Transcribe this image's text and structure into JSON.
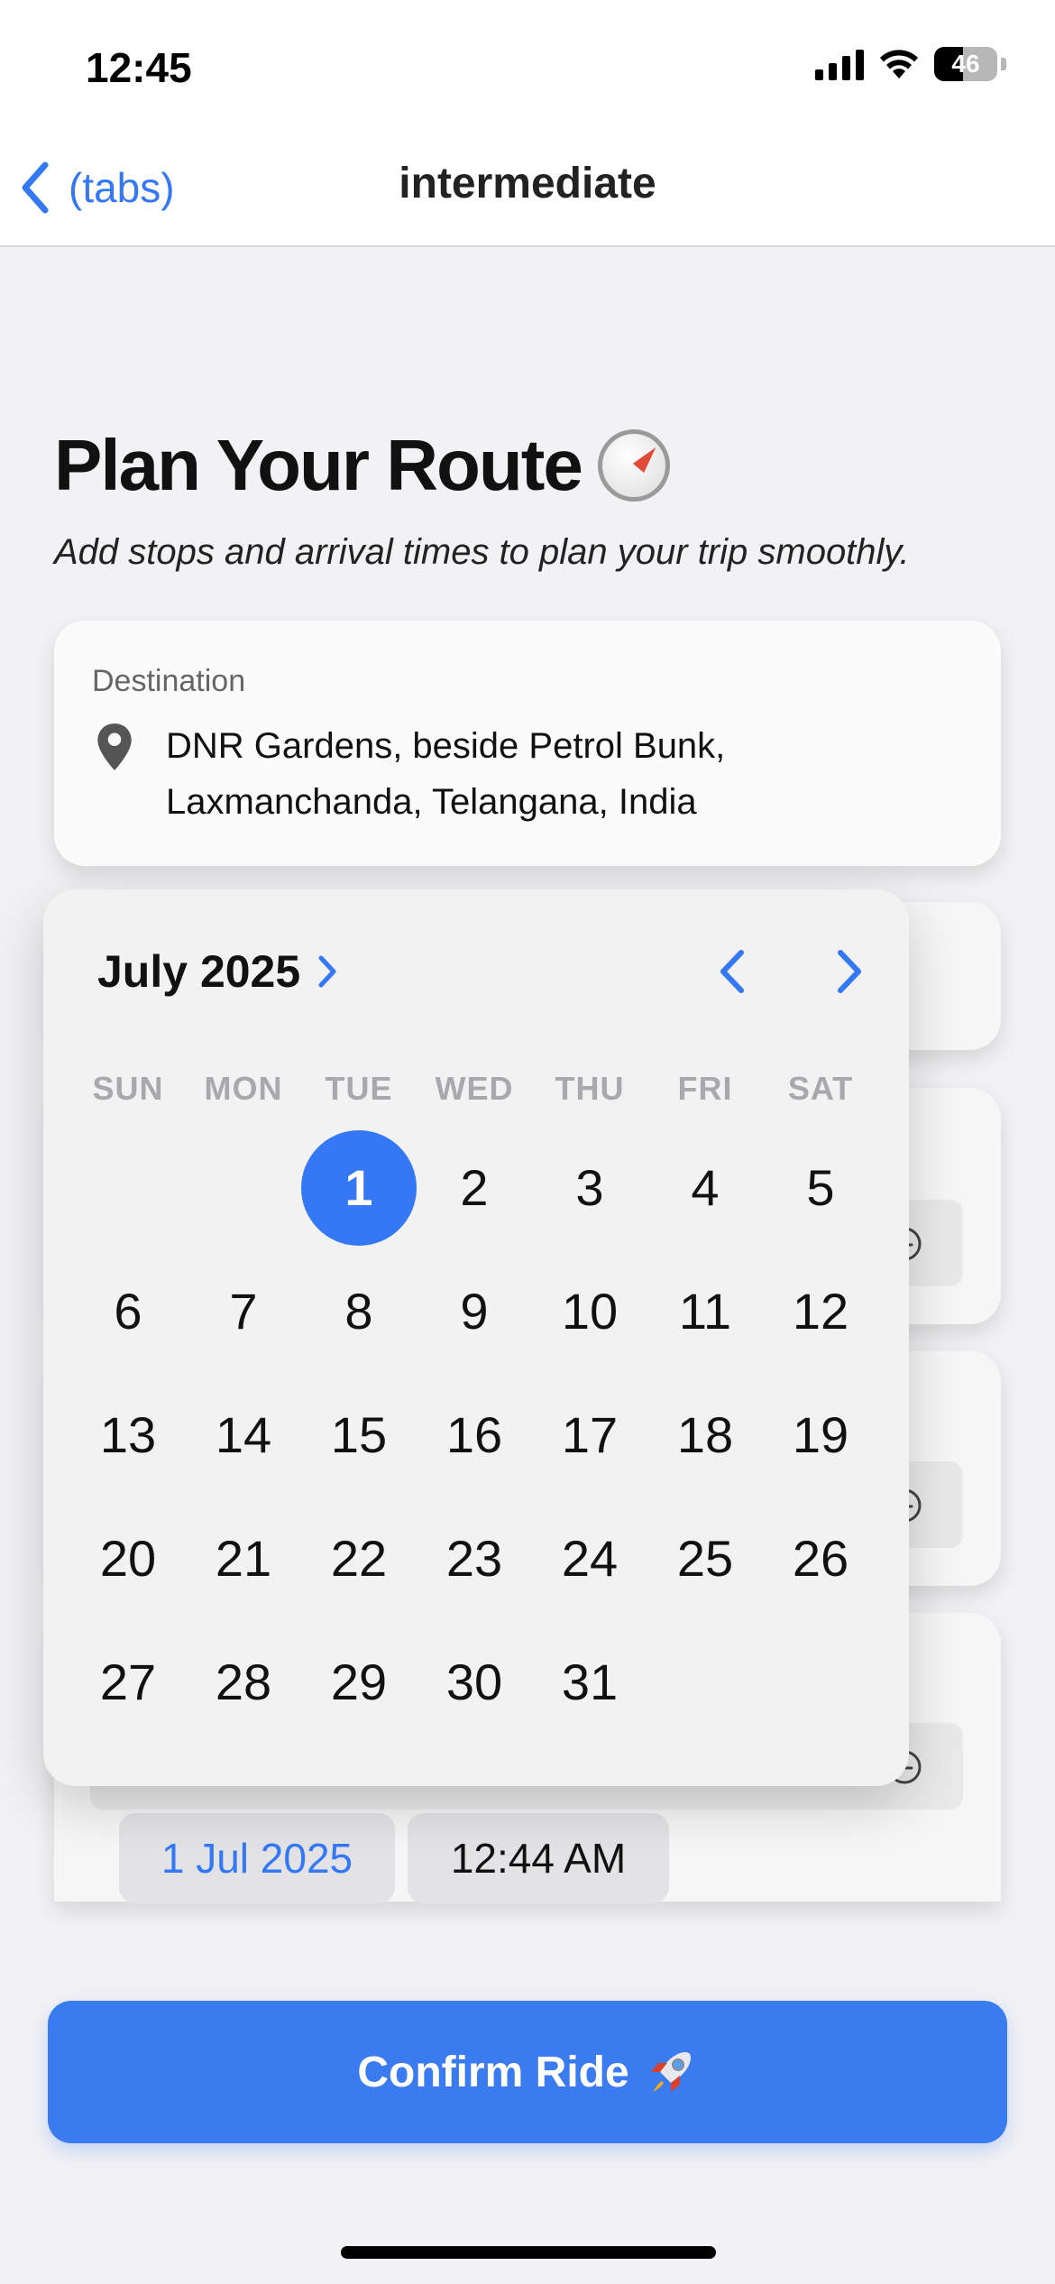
{
  "status_bar": {
    "time": "12:45",
    "battery": "46",
    "battery_level": 0.46
  },
  "nav": {
    "back_label": "(tabs)",
    "title": "intermediate"
  },
  "header": {
    "title": "Plan Your Route",
    "title_icon": "compass-icon",
    "subtitle": "Add stops and arrival times to plan your trip smoothly."
  },
  "destination": {
    "label": "Destination",
    "icon": "location-pin-icon",
    "value": "DNR Gardens, beside Petrol Bunk, Laxmanchanda, Telangana, India"
  },
  "calendar": {
    "month_label": "July 2025",
    "weekdays": [
      "SUN",
      "MON",
      "TUE",
      "WED",
      "THU",
      "FRI",
      "SAT"
    ],
    "selected_day": 1,
    "days": [
      "",
      "",
      "1",
      "2",
      "3",
      "4",
      "5",
      "6",
      "7",
      "8",
      "9",
      "10",
      "11",
      "12",
      "13",
      "14",
      "15",
      "16",
      "17",
      "18",
      "19",
      "20",
      "21",
      "22",
      "23",
      "24",
      "25",
      "26",
      "27",
      "28",
      "29",
      "30",
      "31"
    ]
  },
  "stop_picker": {
    "date": "1 Jul 2025",
    "time": "12:44 AM"
  },
  "confirm": {
    "label": "Confirm Ride",
    "icon": "rocket-icon"
  },
  "colors": {
    "accent": "#3478f6",
    "button": "#3a7bf0",
    "background": "#f2f2f4"
  }
}
